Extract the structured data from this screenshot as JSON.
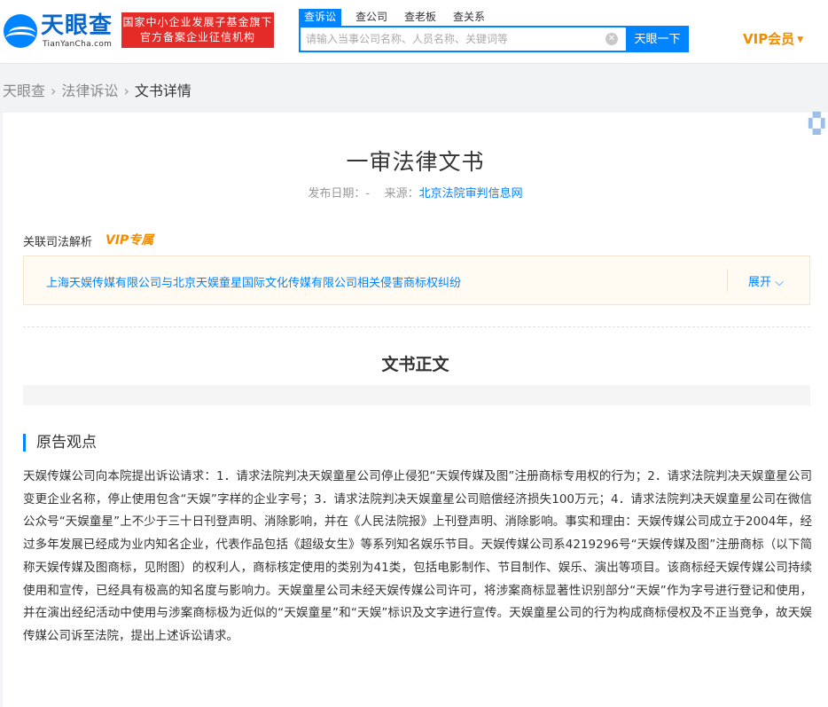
{
  "header": {
    "logo_name": "天眼查",
    "logo_domain": "TianYanCha.com",
    "badge_line1": "国家中小企业发展子基金旗下",
    "badge_line2": "官方备案企业征信机构",
    "search_tabs": [
      "查诉讼",
      "查公司",
      "查老板",
      "查关系"
    ],
    "search_placeholder": "请输入当事公司名称、人员名称、关键词等",
    "search_button": "天眼一下",
    "vip_label": "VIP会员"
  },
  "breadcrumb": [
    "天眼查",
    "法律诉讼",
    "文书详情"
  ],
  "document": {
    "title": "一审法律文书",
    "date_label": "发布日期：-",
    "source_label": "来源：",
    "source_name": "北京法院审判信息网"
  },
  "related": {
    "label": "关联司法解析",
    "vip_tag": "VIP专属",
    "case_title": "上海天娱传媒有限公司与北京天娱童星国际文化传媒有限公司相关侵害商标权纠纷",
    "expand_label": "展开"
  },
  "section": {
    "heading": "文书正文",
    "subheading": "原告观点",
    "body": "天娱传媒公司向本院提出诉讼请求：1．请求法院判决天娱童星公司停止侵犯“天娱传媒及图”注册商标专用权的行为；2．请求法院判决天娱童星公司变更企业名称，停止使用包含“天娱”字样的企业字号；3．请求法院判决天娱童星公司赔偿经济损失100万元；4．请求法院判决天娱童星公司在微信公众号“天娱童星”上不少于三十日刊登声明、消除影响，并在《人民法院报》上刊登声明、消除影响。事实和理由：天娱传媒公司成立于2004年，经过多年发展已经成为业内知名企业，代表作品包括《超级女生》等系列知名娱乐节目。天娱传媒公司系4219296号“天娱传媒及图”注册商标（以下简称天娱传媒及图商标，见附图）的权利人，商标核定使用的类别为41类，包括电影制作、节目制作、娱乐、演出等项目。该商标经天娱传媒公司持续使用和宣传，已经具有极高的知名度与影响力。天娱童星公司未经天娱传媒公司许可，将涉案商标显著性识别部分“天娱”作为字号进行登记和使用，并在演出经纪活动中使用与涉案商标极为近似的“天娱童星”和“天娱”标识及文字进行宣传。天娱童星公司的行为构成商标侵权及不正当竞争，故天娱传媒公司诉至法院，提出上述诉讼请求。"
  },
  "colors": {
    "accent": "#0084ff",
    "vip": "#f08c00",
    "badge": "#e42b28"
  }
}
